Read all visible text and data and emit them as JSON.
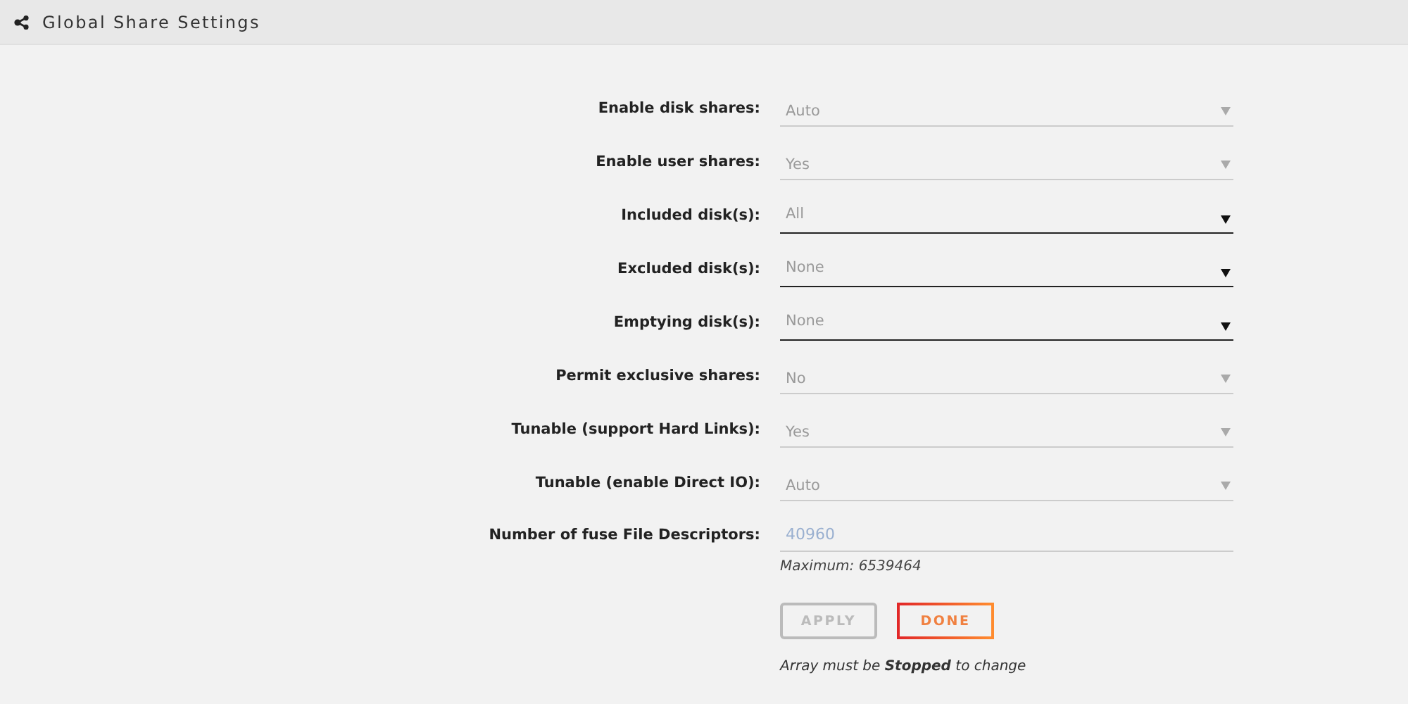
{
  "header": {
    "title": "Global Share Settings"
  },
  "settings": [
    {
      "label": "Enable disk shares:",
      "kind": "select",
      "value": "Auto",
      "disabled": true
    },
    {
      "label": "Enable user shares:",
      "kind": "select",
      "value": "Yes",
      "disabled": true
    },
    {
      "label": "Included disk(s):",
      "kind": "select",
      "value": "All",
      "disabled": false
    },
    {
      "label": "Excluded disk(s):",
      "kind": "select",
      "value": "None",
      "disabled": false
    },
    {
      "label": "Emptying disk(s):",
      "kind": "select",
      "value": "None",
      "disabled": false
    },
    {
      "label": "Permit exclusive shares:",
      "kind": "select",
      "value": "No",
      "disabled": true
    },
    {
      "label": "Tunable (support Hard Links):",
      "kind": "select",
      "value": "Yes",
      "disabled": true
    },
    {
      "label": "Tunable (enable Direct IO):",
      "kind": "select",
      "value": "Auto",
      "disabled": true
    },
    {
      "label": "Number of fuse File Descriptors:",
      "kind": "number",
      "placeholder": "40960",
      "hint": "Maximum: 6539464"
    }
  ],
  "buttons": [
    {
      "label": "APPLY",
      "disabled": true
    },
    {
      "label": "DONE",
      "disabled": false
    }
  ],
  "note": "Array must be **Stopped** to change"
}
